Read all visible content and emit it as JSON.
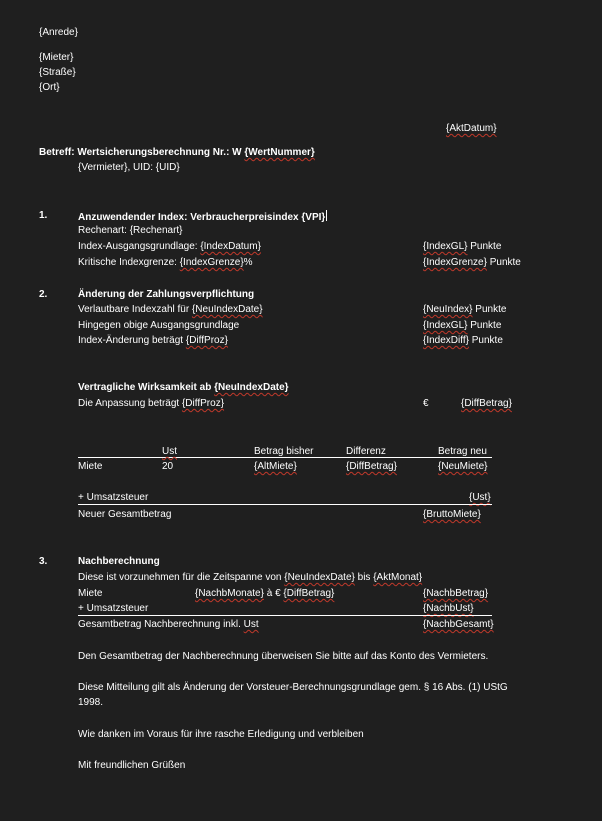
{
  "header": {
    "anrede": "{Anrede}",
    "mieter": "{Mieter}",
    "strasse": "{Straße}",
    "ort": "{Ort}",
    "datum": "{AktDatum}"
  },
  "betreff": {
    "label": "Betreff: Wertsicherungsberechnung Nr.: W ",
    "nummer": "{WertNummer}",
    "vermieter": "{Vermieter}, UID: {UID}"
  },
  "section1": {
    "num": "1.",
    "title": "Anzuwendender Index: Verbraucherpreisindex {VPI}",
    "rechenart": "Rechenart: {Rechenart}",
    "ausgang_prefix": "Index-Ausgangsgrundlage: ",
    "ausgang_field": "{IndexDatum}",
    "ausgang_right_field": "{IndexGL}",
    "ausgang_right_unit": " Punkte",
    "kritisch_prefix": "Kritische Indexgrenze: ",
    "kritisch_field": "{IndexGrenze}",
    "kritisch_suffix": "%",
    "kritisch_right_field": "{IndexGrenze}",
    "kritisch_right_unit": " Punkte"
  },
  "section2": {
    "num": "2.",
    "title": "Änderung der Zahlungsverpflichtung",
    "verlautbar_prefix": "Verlautbare Indexzahl für ",
    "verlautbar_field": "{NeuIndexDate}",
    "verlautbar_right_field": "{NeuIndex}",
    "verlautbar_right_unit": " Punkte",
    "hingegen": "Hingegen obige Ausgangsgrundlage",
    "hingegen_right_field": "{IndexGL}",
    "hingegen_right_unit": " Punkte",
    "aenderung_prefix": "Index-Änderung beträgt ",
    "aenderung_field": "{DiffProz}",
    "aenderung_right_field": "{IndexDiff}",
    "aenderung_right_unit": " Punkte",
    "wirksam_prefix": "Vertragliche Wirksamkeit ab ",
    "wirksam_field": "{NeuIndexDate}",
    "anpassung_prefix": "Die Anpassung beträgt ",
    "anpassung_field": "{DiffProz}",
    "euro": "€",
    "diffbetrag": "{DiffBetrag}"
  },
  "table": {
    "col_ust": "Ust",
    "col_bisher": "Betrag bisher",
    "col_diff": "Differenz",
    "col_neu": "Betrag neu",
    "row_label": "Miete",
    "row_ust": "20",
    "row_bisher": "{AltMiete}",
    "row_diff": "{DiffBetrag}",
    "row_neu": "{NeuMiete}",
    "ust_label": "+ Umsatzsteuer",
    "ust_value": "{Ust}",
    "gesamt_label": "Neuer Gesamtbetrag",
    "gesamt_value": "{BruttoMiete}"
  },
  "section3": {
    "num": "3.",
    "title": "Nachberechnung",
    "zeitspanne_a": "Diese ist vorzunehmen für die Zeitspanne von ",
    "zeitspanne_f1": "{NeuIndexDate}",
    "zeitspanne_b": " bis ",
    "zeitspanne_f2": "{AktMonat}",
    "miete_label": "Miete",
    "monate": "{NachbMonate}",
    "a_euro": " à € ",
    "diffbetrag": "{DiffBetrag}",
    "nachb_betrag": "{NachbBetrag}",
    "ust_label": "+ Umsatzsteuer",
    "nachb_ust": "{NachbUst}",
    "gesamt_label_a": "Gesamtbetrag Nachberechnung inkl. ",
    "gesamt_label_b": "Ust",
    "nachb_gesamt": "{NachbGesamt}"
  },
  "closing": {
    "p1": "Den Gesamtbetrag der Nachberechnung überweisen Sie bitte auf das Konto des Vermieters.",
    "p2_line1": "Diese Mitteilung gilt als Änderung der Vorsteuer-Berechnungsgrundlage gem. § 16 Abs. (1) UStG",
    "p2_line2": "1998.",
    "p3": "Wie danken im Voraus für ihre rasche Erledigung und verbleiben",
    "p4": "Mit freundlichen Grüßen"
  }
}
